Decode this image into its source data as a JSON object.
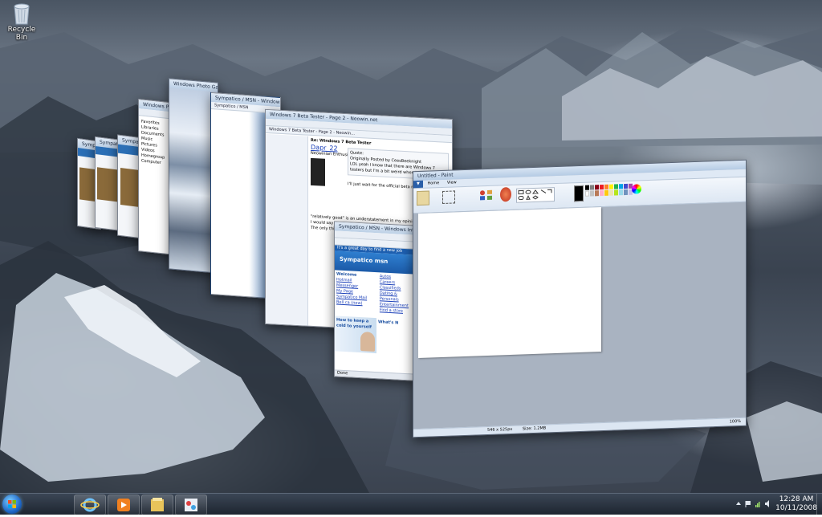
{
  "desktop": {
    "recycle_bin_label": "Recycle Bin"
  },
  "windows": {
    "ie_small_1": {
      "title": "Sympatico / MSN - Windows Internet Explorer"
    },
    "ie_small_2": {
      "title": "Sympatico / MSN - Windows Internet Explorer"
    },
    "ie_small_3": {
      "title": "Sympatico / MSN - Windows Internet Explorer"
    },
    "explorer": {
      "title": "Windows Photo Gallery",
      "side_items": [
        "Favorites",
        "Libraries",
        "Documents",
        "Music",
        "Pictures",
        "Videos",
        "Homegroup",
        "Computer"
      ]
    },
    "photo": {
      "title": "Windows Photo Gallery"
    },
    "ie_msn_mid": {
      "title": "Sympatico / MSN - Windows Internet Explorer",
      "tab": "Sympatico / MSN"
    },
    "ie_forum": {
      "title": "Windows 7 Beta Tester - Page 2 - Neowin.net",
      "tab": "Windows 7 Beta Tester - Page 2 - Neowin...",
      "post_title": "Re: Windows 7 Beta Tester",
      "user": "Dapr_22",
      "user_rank": "Neowinian Enthusiast",
      "quote_header": "Quote:",
      "quote_text": "Originally Posted by CeesBeeknight",
      "body_1": "LOL yeah I know that there are Windows 7 testers but I'm a bit weird when it comes to technology. Sometimes I like to follow the proper channels and I just want to see what's going on.",
      "body_2": "I'll just wait for the official beta release. I probably won't get a chance until then.",
      "body_3": "\"relatively good\" is an understatement in my opinion.",
      "body_4": "I would say that they could do it up and add some stuff.",
      "body_5": "The only thing different in my tests is that the speed could be a little better."
    },
    "ie_msn_front": {
      "title": "Sympatico / MSN - Windows Internet Explorer",
      "tagline": "It's a great day to find a new job",
      "brand": "Sympatico msn",
      "welcome": "Welcome",
      "left_links": [
        "Hotmail",
        "Messenger",
        "My Page",
        "Sympatico Mail",
        "Bell.ca (new)"
      ],
      "right_links": [
        "Autos",
        "Careers",
        "Classifieds",
        "Dating & Personals",
        "Entertainment",
        "Find a store"
      ],
      "promo": "How to keep a cold to yourself",
      "whats_new": "What's N",
      "status": "Done"
    },
    "paint": {
      "title": "Untitled - Paint",
      "tabs": [
        "Home",
        "View"
      ],
      "groups": [
        "Clipboard",
        "Image",
        "Tools",
        "Shapes",
        "Colors"
      ],
      "status_left": "546 x 525px",
      "status_right": "Size: 1.2MB",
      "zoom": "100%",
      "palette": [
        "#000000",
        "#7f7f7f",
        "#880015",
        "#ed1c24",
        "#ff7f27",
        "#fff200",
        "#22b14c",
        "#00a2e8",
        "#3f48cc",
        "#a349a4",
        "#ffffff",
        "#c3c3c3",
        "#b97a57",
        "#ffaec9",
        "#ffc90e",
        "#efe4b0",
        "#b5e61d",
        "#99d9ea",
        "#7092be",
        "#c8bfe7"
      ]
    }
  },
  "taskbar": {
    "time": "12:28 AM",
    "date": "10/11/2008"
  }
}
